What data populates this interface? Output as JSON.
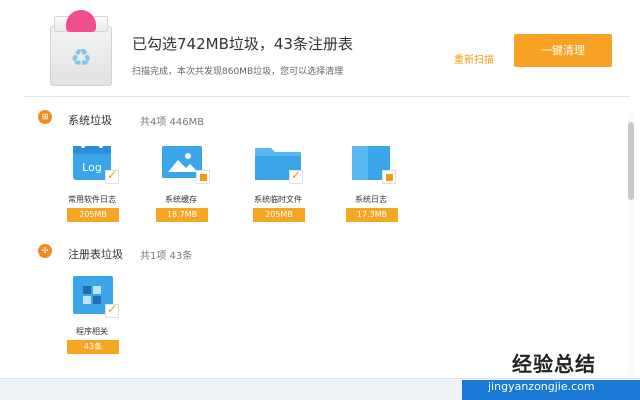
{
  "header": {
    "title": "已勾选742MB垃圾，43条注册表",
    "subtitle": "扫描完成，本次共发现860MB垃圾，您可以选择清理",
    "rescan_label": "重新扫描",
    "clean_label": "一键清理"
  },
  "system": {
    "title": "系统垃圾",
    "count": "共4项 446MB",
    "items": [
      {
        "label": "常用软件日志",
        "size": "205MB",
        "icon": "log-icon",
        "checked": "full"
      },
      {
        "label": "系统缓存",
        "size": "18.7MB",
        "icon": "image-icon",
        "checked": "partial"
      },
      {
        "label": "系统临时文件",
        "size": "205MB",
        "icon": "folder-icon",
        "checked": "full"
      },
      {
        "label": "系统日志",
        "size": "17.3MB",
        "icon": "book-icon",
        "checked": "partial"
      }
    ]
  },
  "registry": {
    "title": "注册表垃圾",
    "count": "共1项 43条",
    "items": [
      {
        "label": "程序相关",
        "size": "43条",
        "icon": "app-grid-icon",
        "checked": "full"
      }
    ]
  },
  "watermark": {
    "main": "经验总结",
    "url": "jingyanzongjie.com"
  },
  "colors": {
    "accent": "#f8a225",
    "icon_blue": "#3ba5ea",
    "bottom_blue": "#1a78d6"
  }
}
